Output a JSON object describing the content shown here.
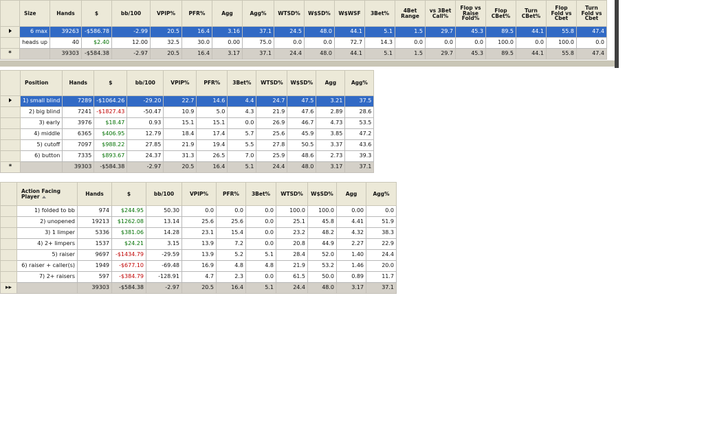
{
  "size_grid": {
    "headers": [
      "Size",
      "Hands",
      "$",
      "bb/100",
      "VPIP%",
      "PFR%",
      "Agg",
      "Agg%",
      "WTSD%",
      "W$SD%",
      "W$WSF",
      "3Bet%",
      "4Bet Range",
      "vs 3Bet Call%",
      "Flop vs Raise Fold%",
      "Flop CBet%",
      "Turn CBet%",
      "Flop Fold vs Cbet",
      "Turn Fold vs Cbet"
    ],
    "rows": [
      {
        "cells": [
          "6 max",
          "39263",
          "-$586.78",
          "-2.99",
          "20.5",
          "16.4",
          "3.16",
          "37.1",
          "24.5",
          "48.0",
          "44.1",
          "5.1",
          "1.5",
          "29.7",
          "45.3",
          "89.5",
          "44.1",
          "55.8",
          "47.4"
        ],
        "money": "neg"
      },
      {
        "cells": [
          "heads up",
          "40",
          "$2.40",
          "12.00",
          "32.5",
          "30.0",
          "0.00",
          "75.0",
          "0.0",
          "0.0",
          "72.7",
          "14.3",
          "0.0",
          "0.0",
          "0.0",
          "100.0",
          "0.0",
          "100.0",
          "0.0"
        ],
        "money": "pos"
      }
    ],
    "total": [
      "",
      "39303",
      "-$584.38",
      "-2.97",
      "20.5",
      "16.4",
      "3.17",
      "37.1",
      "24.4",
      "48.0",
      "44.1",
      "5.1",
      "1.5",
      "29.7",
      "45.3",
      "89.5",
      "44.1",
      "55.8",
      "47.4"
    ]
  },
  "position_grid": {
    "headers": [
      "Position",
      "Hands",
      "$",
      "bb/100",
      "VPIP%",
      "PFR%",
      "3Bet%",
      "WTSD%",
      "W$SD%",
      "Agg",
      "Agg%"
    ],
    "rows": [
      {
        "cells": [
          "1) small blind",
          "7289",
          "-$1064.26",
          "-29.20",
          "22.7",
          "14.6",
          "4.4",
          "24.7",
          "47.5",
          "3.21",
          "37.5"
        ],
        "money": "neg"
      },
      {
        "cells": [
          "2) big blind",
          "7241",
          "-$1827.43",
          "-50.47",
          "10.9",
          "5.0",
          "4.3",
          "21.9",
          "47.6",
          "2.89",
          "28.6"
        ],
        "money": "neg"
      },
      {
        "cells": [
          "3) early",
          "3976",
          "$18.47",
          "0.93",
          "15.1",
          "15.1",
          "0.0",
          "26.9",
          "46.7",
          "4.73",
          "53.5"
        ],
        "money": "pos"
      },
      {
        "cells": [
          "4) middle",
          "6365",
          "$406.95",
          "12.79",
          "18.4",
          "17.4",
          "5.7",
          "25.6",
          "45.9",
          "3.85",
          "47.2"
        ],
        "money": "pos"
      },
      {
        "cells": [
          "5) cutoff",
          "7097",
          "$988.22",
          "27.85",
          "21.9",
          "19.4",
          "5.5",
          "27.8",
          "50.5",
          "3.37",
          "43.6"
        ],
        "money": "pos"
      },
      {
        "cells": [
          "6) button",
          "7335",
          "$893.67",
          "24.37",
          "31.3",
          "26.5",
          "7.0",
          "25.9",
          "48.6",
          "2.73",
          "39.3"
        ],
        "money": "pos"
      }
    ],
    "total": [
      "",
      "39303",
      "-$584.38",
      "-2.97",
      "20.5",
      "16.4",
      "5.1",
      "24.4",
      "48.0",
      "3.17",
      "37.1"
    ]
  },
  "action_grid": {
    "headers": [
      "Action Facing Player",
      "Hands",
      "$",
      "bb/100",
      "VPIP%",
      "PFR%",
      "3Bet%",
      "WTSD%",
      "W$SD%",
      "Agg",
      "Agg%"
    ],
    "rows": [
      {
        "cells": [
          "1) folded to bb",
          "974",
          "$244.95",
          "50.30",
          "0.0",
          "0.0",
          "0.0",
          "100.0",
          "100.0",
          "0.00",
          "0.0"
        ],
        "money": "pos"
      },
      {
        "cells": [
          "2) unopened",
          "19213",
          "$1262.08",
          "13.14",
          "25.6",
          "25.6",
          "0.0",
          "25.1",
          "45.8",
          "4.41",
          "51.9"
        ],
        "money": "pos"
      },
      {
        "cells": [
          "3) 1 limper",
          "5336",
          "$381.06",
          "14.28",
          "23.1",
          "15.4",
          "0.0",
          "23.2",
          "48.2",
          "4.32",
          "38.3"
        ],
        "money": "pos"
      },
      {
        "cells": [
          "4) 2+ limpers",
          "1537",
          "$24.21",
          "3.15",
          "13.9",
          "7.2",
          "0.0",
          "20.8",
          "44.9",
          "2.27",
          "22.9"
        ],
        "money": "pos"
      },
      {
        "cells": [
          "5) raiser",
          "9697",
          "-$1434.79",
          "-29.59",
          "13.9",
          "5.2",
          "5.1",
          "28.4",
          "52.0",
          "1.40",
          "24.4"
        ],
        "money": "neg"
      },
      {
        "cells": [
          "6) raiser + caller(s)",
          "1949",
          "-$677.10",
          "-69.48",
          "16.9",
          "4.8",
          "4.8",
          "21.9",
          "53.2",
          "1.46",
          "20.0"
        ],
        "money": "neg"
      },
      {
        "cells": [
          "7) 2+ raisers",
          "597",
          "-$384.79",
          "-128.91",
          "4.7",
          "2.3",
          "0.0",
          "61.5",
          "50.0",
          "0.89",
          "11.7"
        ],
        "money": "neg"
      }
    ],
    "total": [
      "",
      "39303",
      "-$584.38",
      "-2.97",
      "20.5",
      "16.4",
      "5.1",
      "24.4",
      "48.0",
      "3.17",
      "37.1"
    ]
  },
  "glyphs": {
    "new_row": "*",
    "total_marker": "▸▸"
  }
}
